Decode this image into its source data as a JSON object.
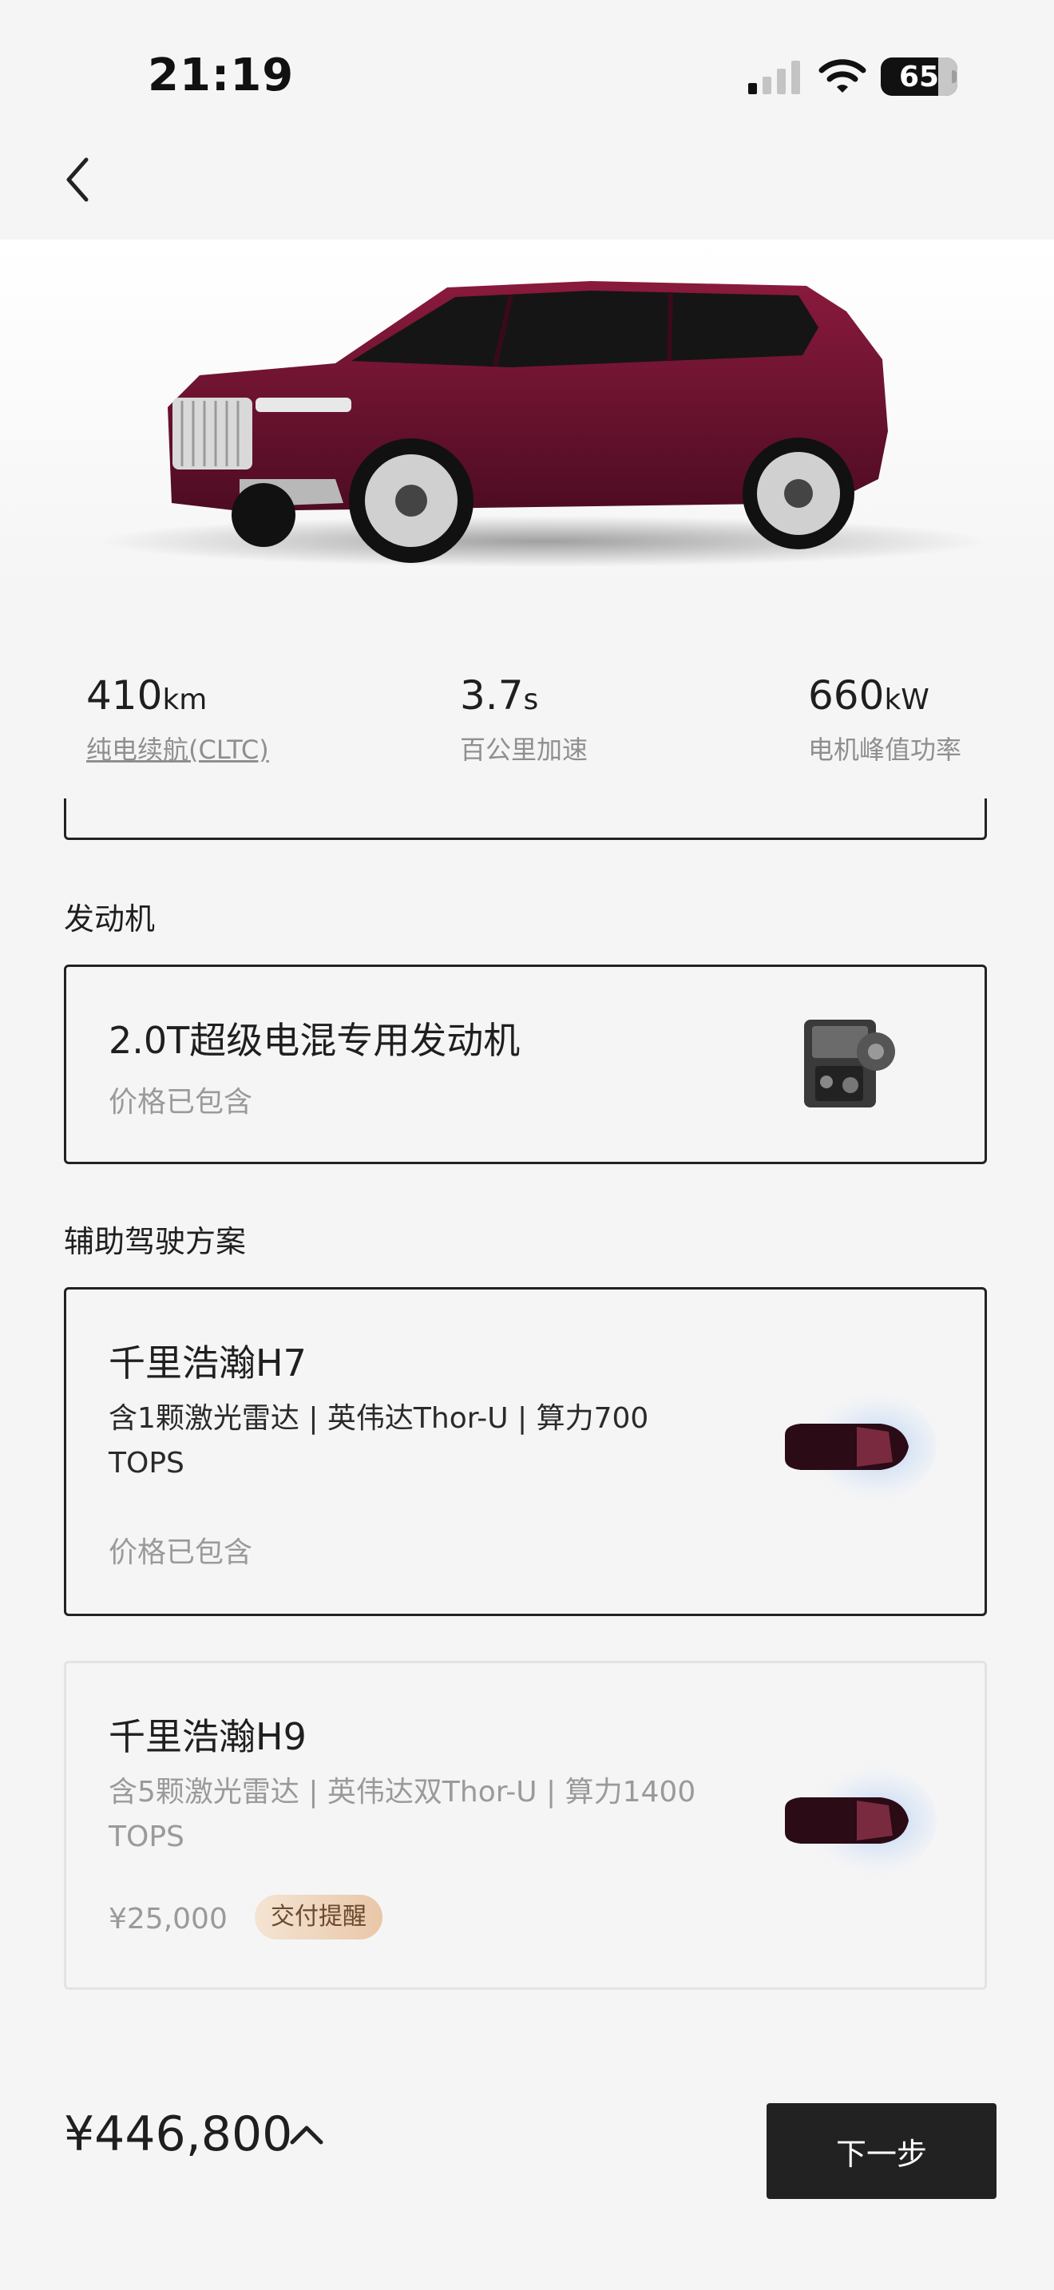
{
  "status_bar": {
    "time": "21:19",
    "battery": "65"
  },
  "specs": [
    {
      "value": "410",
      "unit": "km",
      "label": "纯电续航(CLTC)"
    },
    {
      "value": "3.7",
      "unit": "s",
      "label": "百公里加速"
    },
    {
      "value": "660",
      "unit": "kW",
      "label": "电机峰值功率"
    }
  ],
  "engine_section": {
    "title": "发动机",
    "option": {
      "name": "2.0T超级电混专用发动机",
      "price": "价格已包含"
    }
  },
  "adas_section": {
    "title": "辅助驾驶方案",
    "options": [
      {
        "name": "千里浩瀚H7",
        "desc": "含1颗激光雷达 | 英伟达Thor-U | 算力700 TOPS",
        "price": "价格已包含"
      },
      {
        "name": "千里浩瀚H9",
        "desc": "含5颗激光雷达 | 英伟达双Thor-U | 算力1400 TOPS",
        "price": "¥25,000",
        "badge": "交付提醒"
      }
    ]
  },
  "footer": {
    "total": "¥446,800",
    "next_label": "下一步"
  },
  "colors": {
    "car_body": "#6e1230",
    "button": "#222222",
    "badge_start": "#f4e4d3",
    "badge_end": "#e9c7a8"
  }
}
